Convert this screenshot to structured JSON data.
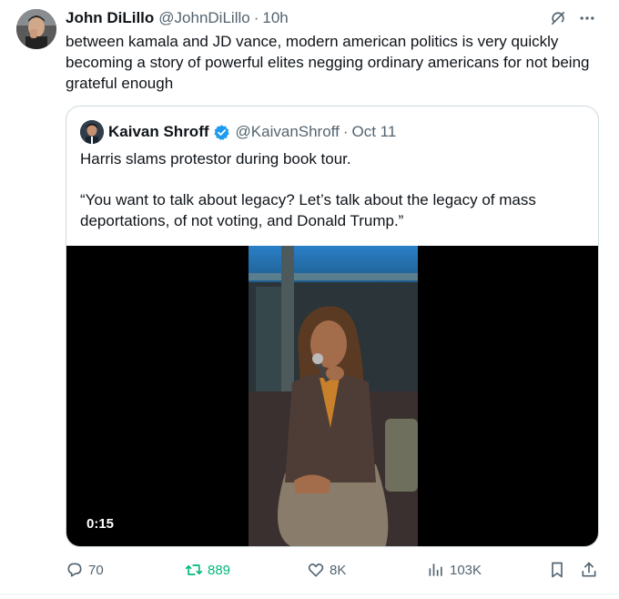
{
  "tweet": {
    "author_name": "John DiLillo",
    "author_handle": "@JohnDiLillo",
    "separator": "·",
    "time": "10h",
    "text": "between kamala and JD vance, modern american politics is very quickly becoming a story of powerful elites negging ordinary americans for not being grateful enough"
  },
  "header_icons": [
    "grok-icon",
    "more-icon"
  ],
  "quoted_tweet": {
    "author_name": "Kaivan Shroff",
    "verified": true,
    "author_handle": "@KaivanShroff",
    "separator": "·",
    "time": "Oct 11",
    "text_line1": "Harris slams protestor during book tour.",
    "text_line2": "“You want to talk about legacy? Let’s talk about the legacy of mass deportations, of not voting, and Donald Trump.”",
    "video_duration": "0:15"
  },
  "actions": {
    "replies": "70",
    "retweets": "889",
    "likes": "8K",
    "views": "103K"
  },
  "colors": {
    "text": "#0f1419",
    "secondary": "#536471",
    "retweet": "#00ba7c",
    "verified": "#1d9bf0",
    "border": "#cfd9de"
  }
}
